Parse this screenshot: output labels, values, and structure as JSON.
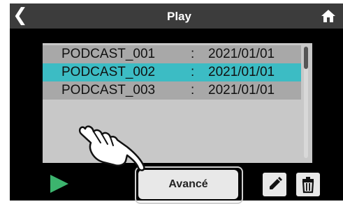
{
  "header": {
    "title": "Play",
    "back_icon": "chevron-left-icon",
    "home_icon": "home-icon"
  },
  "files": [
    {
      "name": "PODCAST_001",
      "sep": ":",
      "date": "2021/01/01",
      "selected": false
    },
    {
      "name": "PODCAST_002",
      "sep": ":",
      "date": "2021/01/01",
      "selected": true
    },
    {
      "name": "PODCAST_003",
      "sep": ":",
      "date": "2021/01/01",
      "selected": false
    }
  ],
  "controls": {
    "play_icon": "play-icon",
    "advanced_label": "Avancé",
    "edit_icon": "pencil-icon",
    "delete_icon": "trash-icon"
  },
  "colors": {
    "selected": "#3cbcc4",
    "play": "#3cb46e"
  }
}
